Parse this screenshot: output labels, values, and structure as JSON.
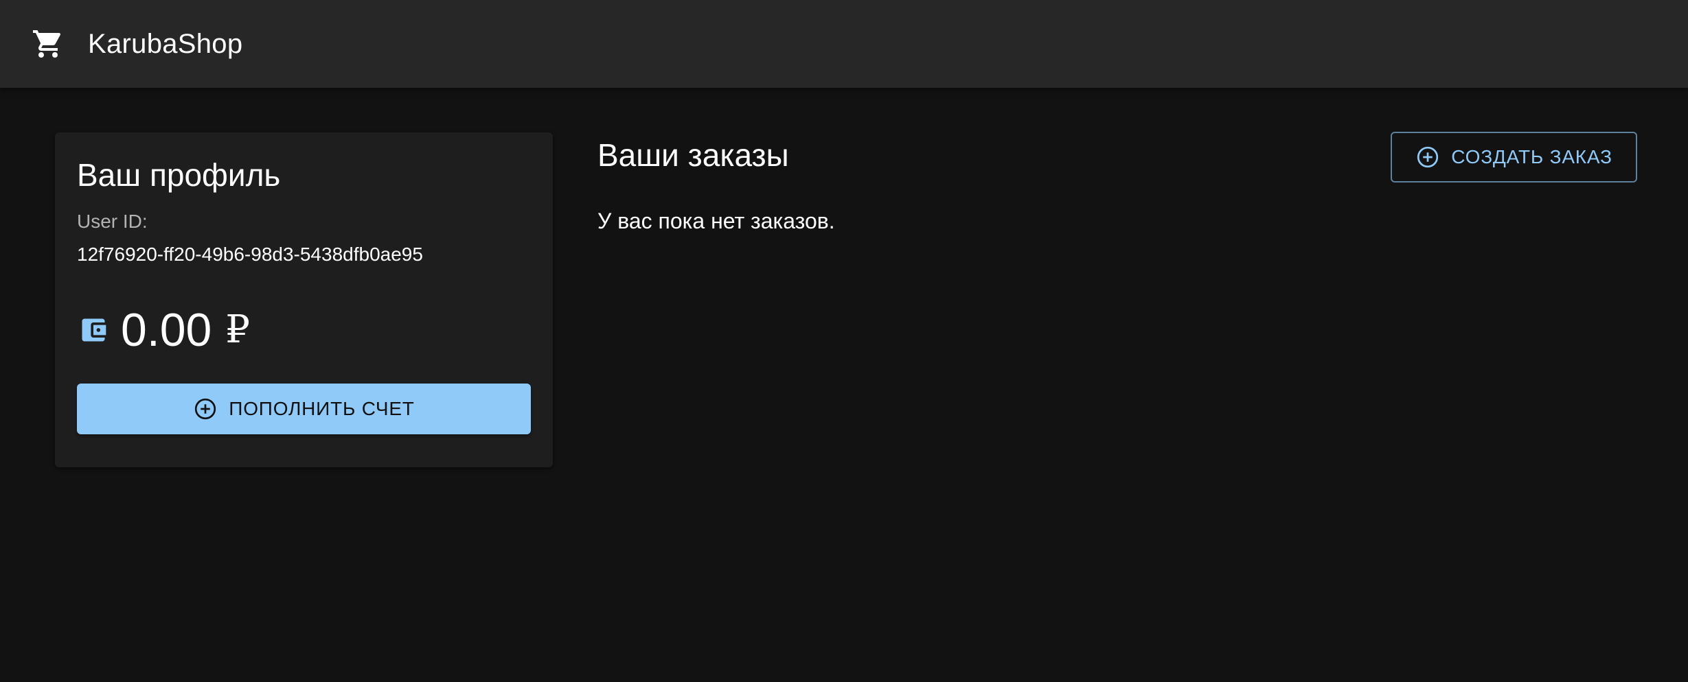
{
  "appbar": {
    "brand": "KarubaShop",
    "icon": "cart-icon"
  },
  "profile": {
    "title": "Ваш профиль",
    "user_id_label": "User ID:",
    "user_id_value": "12f76920-ff20-49b6-98d3-5438dfb0ae95",
    "balance_icon": "wallet-icon",
    "balance_amount": "0.00",
    "balance_currency": "₽",
    "topup_button": {
      "label": "ПОПОЛНИТЬ СЧЕТ",
      "icon": "add-circle-icon"
    }
  },
  "orders": {
    "title": "Ваши заказы",
    "empty_text": "У вас пока нет заказов.",
    "create_button": {
      "label": "СОЗДАТЬ ЗАКАЗ",
      "icon": "add-circle-icon"
    }
  },
  "colors": {
    "background": "#121212",
    "appbar": "#272727",
    "card": "#1e1e1e",
    "primary": "#90caf9"
  }
}
